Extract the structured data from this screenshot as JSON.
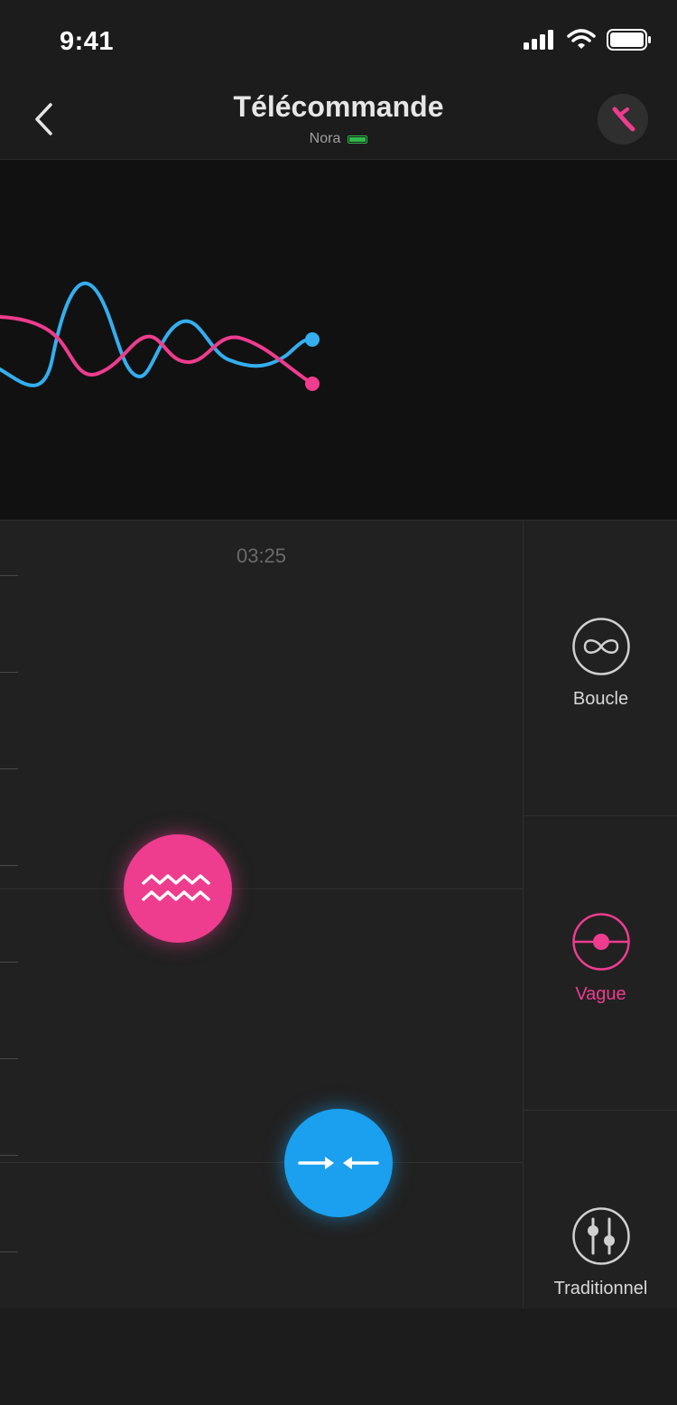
{
  "status_bar": {
    "time": "9:41"
  },
  "nav": {
    "title": "Télécommande",
    "device_name": "Nora"
  },
  "timer": "03:25",
  "modes": [
    {
      "label": "Boucle",
      "icon": "infinity-icon",
      "active": false
    },
    {
      "label": "Vague",
      "icon": "wave-target-icon",
      "active": true
    },
    {
      "label": "Traditionnel",
      "icon": "sliders-icon",
      "active": false
    }
  ],
  "colors": {
    "pink": "#ee3c8e",
    "blue": "#1aa0ee",
    "background": "#212121",
    "preview_background": "#111111"
  }
}
